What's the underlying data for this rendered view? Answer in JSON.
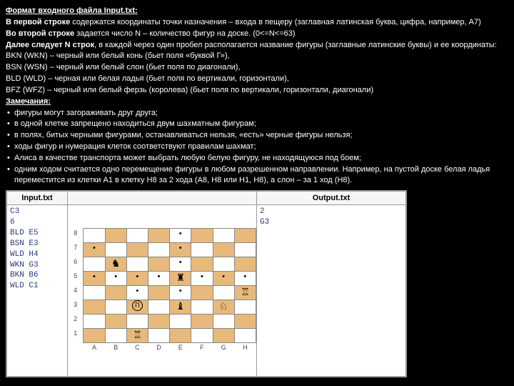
{
  "intro": {
    "heading": "Формат входного файла Input.txt:",
    "line1a": "В первой строке ",
    "line1b": "содержатся координаты точки назначения – входа в пещеру (заглавная латинская буква, цифра, например, A7)",
    "line2a": "Во второй строке ",
    "line2b": "задается число N – количество фигур на доске. (0<=N<=63)",
    "line3a": "Далее следует N строк",
    "line3b": ", в каждой через один пробел располагается название фигуры (заглавные латинские буквы) и ее координаты:",
    "p_bkn": "BKN (WKN) – черный или белый конь (бьет поля «буквой Г»),",
    "p_bsn": "BSN (WSN) – черный или белый слон (бьет поля по диагонали),",
    "p_bld": "BLD (WLD) – черная или белая ладья (бьет поля по вертикали, горизонтали),",
    "p_bfz": "BFZ (WFZ) – черный или белый ферзь (королева) (бьет поля по вертикали, горизонтали, диагонали)"
  },
  "notes": {
    "heading": "Замечания:",
    "b1": "фигуры могут загораживать друг друга;",
    "b2": "в одной клетке запрещено находиться двум шахматным фигурам;",
    "b3": "в полях, битых черными фигурами, останавливаться нельзя, «есть» черные фигуры нельзя;",
    "b4": "ходы фигур и нумерация клеток соответствуют правилам шахмат;",
    "b5": "Алиса в качестве транспорта может выбрать любую белую фигуру, не находящуюся под боем;",
    "b6": "одним ходом считается одно перемещение фигуры в любом разрешенном направлении. Например, на пустой доске белая ладья переместится из клетки A1 в клетку H8 за 2 хода (A8, H8 или H1, H8), а слон – за 1 ход (H8)."
  },
  "example": {
    "hdr_in": "Input.txt",
    "hdr_out": "Output.txt",
    "input": "C3\n6\nBLD E5\nBSN E3\nWLD H4\nWKN G3\nBKN B6\nWLD C1",
    "output": "2\nG3",
    "files": [
      "A",
      "B",
      "C",
      "D",
      "E",
      "F",
      "G",
      "H"
    ],
    "ranks": [
      "8",
      "7",
      "6",
      "5",
      "4",
      "3",
      "2",
      "1"
    ],
    "pieces": {
      "E5": "♜",
      "E3": "♝",
      "H4": "♖",
      "G3": "♘",
      "B6": "♞",
      "C1": "♖"
    },
    "dots": [
      "A5",
      "B5",
      "C5",
      "D5",
      "F5",
      "G5",
      "H5",
      "E8",
      "E7",
      "E6",
      "E4",
      "A7",
      "C4"
    ],
    "start_label": "П",
    "start_cell": "C3"
  }
}
